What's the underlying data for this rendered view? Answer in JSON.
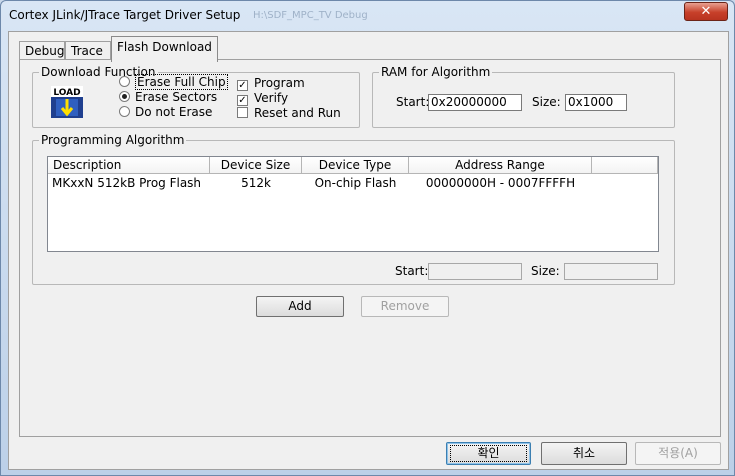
{
  "window": {
    "title": "Cortex JLink/JTrace Target Driver Setup",
    "title_extra": "H:\\SDF_MPC_TV Debug",
    "close_label": "✕"
  },
  "tabs": [
    {
      "label": "Debug"
    },
    {
      "label": "Trace"
    },
    {
      "label": "Flash Download",
      "active": true
    }
  ],
  "download_function": {
    "label": "Download Function",
    "icon": "load-icon",
    "icon_text": "LOAD",
    "options": [
      {
        "label": "Erase Full Chip",
        "selected": false
      },
      {
        "label": "Erase Sectors",
        "selected": true
      },
      {
        "label": "Do not Erase",
        "selected": false
      }
    ],
    "checks": [
      {
        "label": "Program",
        "checked": true
      },
      {
        "label": "Verify",
        "checked": true
      },
      {
        "label": "Reset and Run",
        "checked": false
      }
    ]
  },
  "ram_for_algorithm": {
    "label": "RAM for Algorithm",
    "start_label": "Start:",
    "start_value": "0x20000000",
    "size_label": "Size:",
    "size_value": "0x1000"
  },
  "programming_algorithm": {
    "label": "Programming Algorithm",
    "columns": [
      "Description",
      "Device Size",
      "Device Type",
      "Address Range"
    ],
    "rows": [
      {
        "description": "MKxxN 512kB Prog Flash",
        "device_size": "512k",
        "device_type": "On-chip Flash",
        "address_range": "00000000H - 0007FFFFH"
      }
    ],
    "start_label": "Start:",
    "start_value": "",
    "size_label": "Size:",
    "size_value": ""
  },
  "actions": {
    "add_label": "Add",
    "remove_label": "Remove"
  },
  "footer": {
    "ok_label": "확인",
    "cancel_label": "취소",
    "apply_label": "적용(A)"
  },
  "colors": {
    "close_button": "#c7402a",
    "titlebar": "#d9e6f5",
    "dialog_bg": "#f0f0f0"
  }
}
